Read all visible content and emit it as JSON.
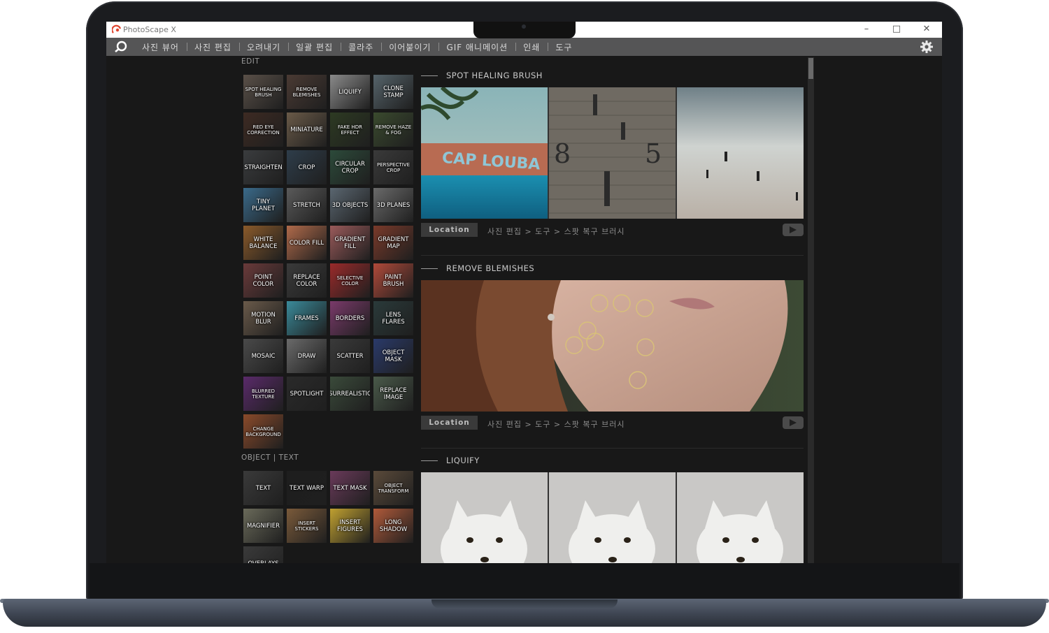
{
  "window": {
    "title": "PhotoScape X"
  },
  "menu": {
    "items": [
      "사진 뷰어",
      "사진 편집",
      "오려내기",
      "일괄 편집",
      "콜라주",
      "이어붙이기",
      "GIF 애니메이션",
      "인쇄",
      "도구"
    ]
  },
  "left_panel": {
    "edit_label": "EDIT",
    "edit_tools": [
      {
        "label": "SPOT HEALING BRUSH",
        "bg": "#5a5048"
      },
      {
        "label": "REMOVE BLEMISHES",
        "bg": "#4a3a33"
      },
      {
        "label": "LIQUIFY",
        "bg": "#8a8a8a"
      },
      {
        "label": "CLONE STAMP",
        "bg": "#55636a"
      },
      {
        "label": "RED EYE CORRECTION",
        "bg": "#3d2a22"
      },
      {
        "label": "MINIATURE",
        "bg": "#6a5a48"
      },
      {
        "label": "FAKE HDR EFFECT",
        "bg": "#2d3a22"
      },
      {
        "label": "REMOVE HAZE & FOG",
        "bg": "#3a4a2e"
      },
      {
        "label": "STRAIGHTEN",
        "bg": "#3a3c3e"
      },
      {
        "label": "CROP",
        "bg": "#2e3d4a"
      },
      {
        "label": "CIRCULAR CROP",
        "bg": "#2c4a3a"
      },
      {
        "label": "PERSPECTIVE CROP",
        "bg": "#3a3a3a"
      },
      {
        "label": "TINY PLANET",
        "bg": "#3a6a8a"
      },
      {
        "label": "STRETCH",
        "bg": "#5a5a5a"
      },
      {
        "label": "3D OBJECTS",
        "bg": "#5a6670"
      },
      {
        "label": "3D PLANES",
        "bg": "#6a6a6a"
      },
      {
        "label": "WHITE BALANCE",
        "bg": "#8a5a2a"
      },
      {
        "label": "COLOR FILL",
        "bg": "#b06a4a"
      },
      {
        "label": "GRADIENT FILL",
        "bg": "#9a5a5a"
      },
      {
        "label": "GRADIENT MAP",
        "bg": "#7a3a2a"
      },
      {
        "label": "POINT COLOR",
        "bg": "#6a3a3a"
      },
      {
        "label": "REPLACE COLOR",
        "bg": "#3a3a3a"
      },
      {
        "label": "SELECTIVE COLOR",
        "bg": "#9a2a2a"
      },
      {
        "label": "PAINT BRUSH",
        "bg": "#b04a3a"
      },
      {
        "label": "MOTION BLUR",
        "bg": "#6a5a4a"
      },
      {
        "label": "FRAMES",
        "bg": "#3a8a9a"
      },
      {
        "label": "BORDERS",
        "bg": "#7a3a6a"
      },
      {
        "label": "LENS FLARES",
        "bg": "#2a3a3a"
      },
      {
        "label": "MOSAIC",
        "bg": "#4a4a4a"
      },
      {
        "label": "DRAW",
        "bg": "#6a6a6a"
      },
      {
        "label": "SCATTER",
        "bg": "#3a3a3a"
      },
      {
        "label": "OBJECT MASK",
        "bg": "#2a3a6a"
      },
      {
        "label": "BLURRED TEXTURE",
        "bg": "#5a2a6a"
      },
      {
        "label": "SPOTLIGHT",
        "bg": "#2a2a2a"
      },
      {
        "label": "SURREALISTIC",
        "bg": "#3a4a3a"
      },
      {
        "label": "REPLACE IMAGE",
        "bg": "#4a5a4a"
      },
      {
        "label": "CHANGE BACKGROUND",
        "bg": "#8a4a2a"
      }
    ],
    "object_text_label": "OBJECT | TEXT",
    "object_tools": [
      {
        "label": "TEXT",
        "bg": "#3a3a3a"
      },
      {
        "label": "TEXT WARP",
        "bg": "#1e1e1e"
      },
      {
        "label": "TEXT MASK",
        "bg": "#6a3a5a"
      },
      {
        "label": "OBJECT TRANSFORM",
        "bg": "#5a4a3a"
      },
      {
        "label": "MAGNIFIER",
        "bg": "#6a6a5a"
      },
      {
        "label": "INSERT STICKERS",
        "bg": "#7a5a3a"
      },
      {
        "label": "INSERT FIGURES",
        "bg": "#c0a030"
      },
      {
        "label": "LONG SHADOW",
        "bg": "#b05a3a"
      },
      {
        "label": "OVERLAYS",
        "bg": "#3a3a3a"
      }
    ]
  },
  "features": [
    {
      "title": "SPOT HEALING BRUSH",
      "location_label": "Location",
      "path": "사진 편집 > 도구 > 스팟 복구 브러시"
    },
    {
      "title": "REMOVE BLEMISHES",
      "location_label": "Location",
      "path": "사진 편집 > 도구 > 스팟 복구 브러시"
    },
    {
      "title": "LIQUIFY"
    }
  ],
  "colors": {
    "menubar": "#555556",
    "background": "#181818",
    "accent_circle": "#d8c07a"
  }
}
